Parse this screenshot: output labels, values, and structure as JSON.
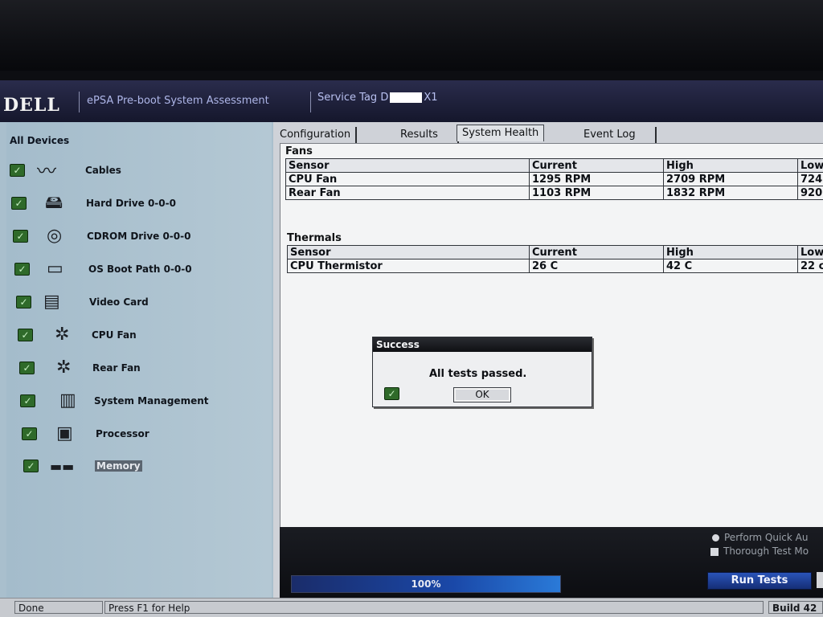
{
  "titlebar": {
    "logo": "DELL",
    "app_title": "ePSA Pre-boot System Assessment",
    "service_tag_prefix": "Service Tag D",
    "service_tag_suffix": "X1"
  },
  "devices": {
    "header": "All Devices",
    "items": [
      {
        "label": "Cables",
        "icon": "cable-icon"
      },
      {
        "label": "Hard Drive 0-0-0",
        "icon": "hard-drive-icon"
      },
      {
        "label": "CDROM Drive 0-0-0",
        "icon": "cdrom-icon"
      },
      {
        "label": "OS Boot Path 0-0-0",
        "icon": "boot-path-icon"
      },
      {
        "label": "Video Card",
        "icon": "video-card-icon"
      },
      {
        "label": "CPU Fan",
        "icon": "fan-icon"
      },
      {
        "label": "Rear Fan",
        "icon": "fan-icon"
      },
      {
        "label": "System Management",
        "icon": "system-management-icon"
      },
      {
        "label": "Processor",
        "icon": "processor-icon"
      },
      {
        "label": "Memory",
        "icon": "memory-icon"
      }
    ]
  },
  "tabs": [
    {
      "label": "Configuration"
    },
    {
      "label": "Results"
    },
    {
      "label": "System Health",
      "active": true
    },
    {
      "label": "Event Log"
    }
  ],
  "fans": {
    "title": "Fans",
    "headers": [
      "Sensor",
      "Current",
      "High",
      "Low"
    ],
    "rows": [
      [
        "CPU Fan",
        "1295 RPM",
        "2709 RPM",
        "724"
      ],
      [
        "Rear Fan",
        "1103 RPM",
        "1832 RPM",
        "920"
      ]
    ]
  },
  "thermals": {
    "title": "Thermals",
    "headers": [
      "Sensor",
      "Current",
      "High",
      "Low"
    ],
    "rows": [
      [
        "CPU Thermistor",
        "26 C",
        "42 C",
        "22 c"
      ]
    ]
  },
  "dialog": {
    "title": "Success",
    "message": "All tests passed.",
    "ok_label": "OK"
  },
  "controls": {
    "quick_label": "Perform Quick Au",
    "thorough_label": "Thorough Test Mo",
    "progress_percent": 100,
    "progress_text": "100%",
    "run_label": "Run Tests"
  },
  "statusbar": {
    "status": "Done",
    "help": "Press F1 for Help",
    "build": "Build  42"
  },
  "colors": {
    "titlebar": "#15172c",
    "check_green": "#2f6a2a",
    "run_button": "#1f3f9a"
  }
}
